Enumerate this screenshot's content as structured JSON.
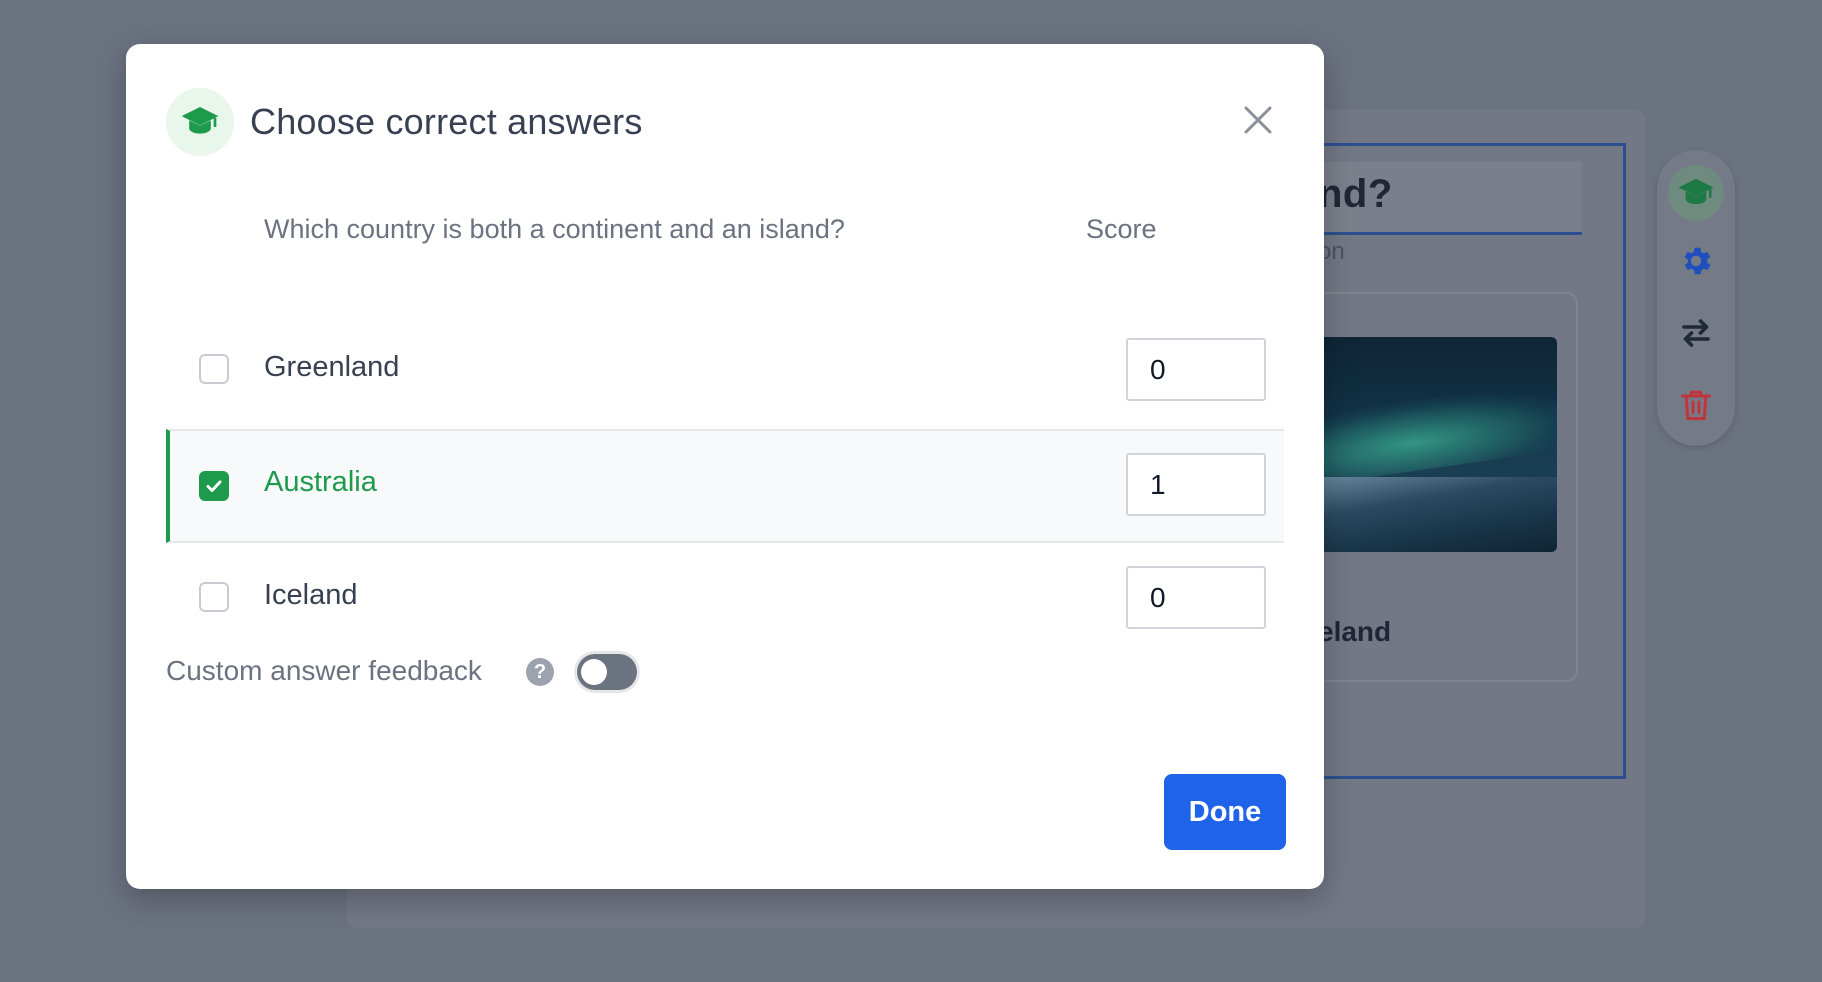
{
  "background": {
    "block_title_fragment": "nd?",
    "block_subtitle_fragment": "on",
    "visible_option_fragment": "eland",
    "toolbar": {
      "icons": [
        "graduation-cap-icon",
        "gear-icon",
        "swap-icon",
        "trash-icon"
      ]
    }
  },
  "modal": {
    "title": "Choose correct answers",
    "icon": "graduation-cap-icon",
    "question": "Which country is both a continent and an island?",
    "score_header": "Score",
    "options": [
      {
        "label": "Greenland",
        "checked": false,
        "score": "0"
      },
      {
        "label": "Australia",
        "checked": true,
        "score": "1"
      },
      {
        "label": "Iceland",
        "checked": false,
        "score": "0"
      }
    ],
    "feedback_label": "Custom answer feedback",
    "help_glyph": "?",
    "feedback_enabled": false,
    "done_label": "Done"
  },
  "colors": {
    "accent_green": "#1d9a4b",
    "primary_blue": "#1f63e8",
    "overlay": "#6b7280",
    "danger_red": "#c0343c"
  }
}
